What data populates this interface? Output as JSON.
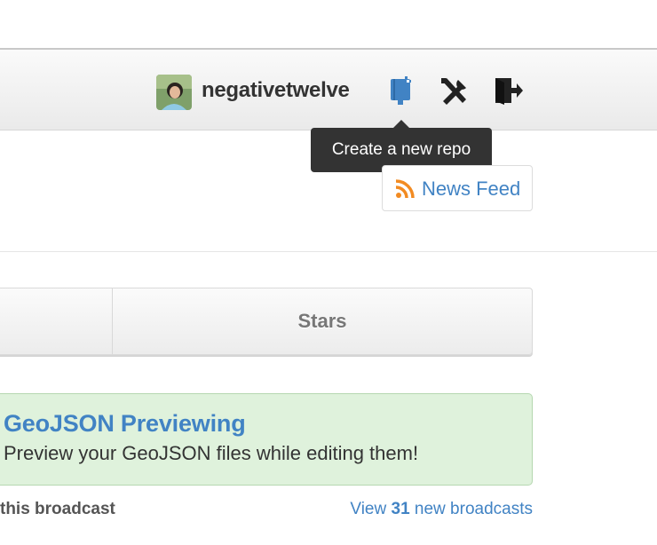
{
  "header": {
    "username": "negativetwelve",
    "avatar_icon": "user-avatar",
    "icons": [
      "create-repo-icon",
      "account-settings-icon",
      "sign-out-icon"
    ],
    "tooltip": "Create a new repo"
  },
  "news_feed": {
    "icon": "rss-icon",
    "label": "News Feed"
  },
  "tabs": {
    "stars_label": "Stars"
  },
  "broadcast": {
    "title": "GeoJSON Previewing",
    "body": "Preview your GeoJSON files while editing them!"
  },
  "footer": {
    "left_text": "this broadcast",
    "view_prefix": "View",
    "view_count": "31",
    "view_suffix": "new broadcasts"
  },
  "colors": {
    "link": "#4183c4",
    "broadcast_bg": "#dff2dc",
    "rss": "#f28b22",
    "tooltip_bg": "#333333"
  }
}
